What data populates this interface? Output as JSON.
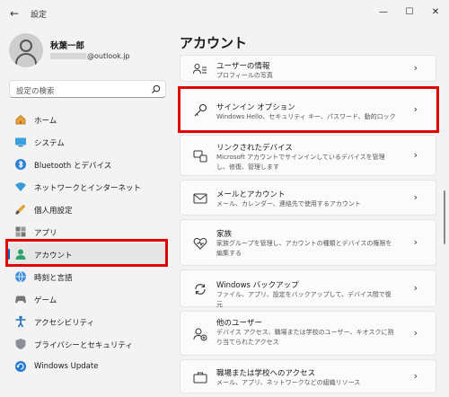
{
  "window": {
    "title": "設定",
    "back_glyph": "←",
    "minimize_glyph": "—",
    "maximize_glyph": "☐",
    "close_glyph": "✕"
  },
  "profile": {
    "name": "秋葉一郎",
    "email_domain": "@outlook.jp"
  },
  "search": {
    "placeholder": "設定の検索"
  },
  "sidebar": {
    "items": [
      {
        "label": "ホーム",
        "icon": "home-icon"
      },
      {
        "label": "システム",
        "icon": "system-icon"
      },
      {
        "label": "Bluetooth とデバイス",
        "icon": "bluetooth-icon"
      },
      {
        "label": "ネットワークとインターネット",
        "icon": "network-icon"
      },
      {
        "label": "個人用設定",
        "icon": "personalization-icon"
      },
      {
        "label": "アプリ",
        "icon": "apps-icon"
      },
      {
        "label": "アカウント",
        "icon": "account-icon"
      },
      {
        "label": "時刻と言語",
        "icon": "time-language-icon"
      },
      {
        "label": "ゲーム",
        "icon": "gaming-icon"
      },
      {
        "label": "アクセシビリティ",
        "icon": "accessibility-icon"
      },
      {
        "label": "プライバシーとセキュリティ",
        "icon": "privacy-shield-icon"
      },
      {
        "label": "Windows Update",
        "icon": "windows-update-icon"
      }
    ],
    "active": "アカウント"
  },
  "main": {
    "title": "アカウント",
    "cards": [
      {
        "title": "ユーザーの情報",
        "subtitle": "プロフィールの写真",
        "icon": "user-info-icon"
      },
      {
        "title": "サインイン オプション",
        "subtitle": "Windows Hello、セキュリティ キー、パスワード、動的ロック",
        "icon": "key-icon"
      },
      {
        "title": "リンクされたデバイス",
        "subtitle": "Microsoft アカウントでサインインしているデバイスを管理し、修復、管理します",
        "icon": "linked-devices-icon"
      },
      {
        "title": "メールとアカウント",
        "subtitle": "メール、カレンダー、連絡先で使用するアカウント",
        "icon": "mail-icon"
      },
      {
        "title": "家族",
        "subtitle": "家族グループを管理し、アカウントの種類とデバイスの権限を編集する",
        "icon": "family-heart-icon"
      },
      {
        "title": "Windows バックアップ",
        "subtitle": "ファイル、アプリ、設定をバックアップして、デバイス間で復元",
        "icon": "backup-icon"
      },
      {
        "title": "他のユーザー",
        "subtitle": "デバイス アクセス、職場または学校のユーザー、キオスクに割り当てられたアクセス",
        "icon": "other-users-icon"
      },
      {
        "title": "職場または学校へのアクセス",
        "subtitle": "メール、アプリ、ネットワークなどの組織リソース",
        "icon": "briefcase-icon"
      }
    ],
    "chevron": "›"
  },
  "colors": {
    "accent": "#0067c0",
    "highlight": "#e00000",
    "background": "#f3f3f3",
    "card": "#fbfbfb"
  }
}
